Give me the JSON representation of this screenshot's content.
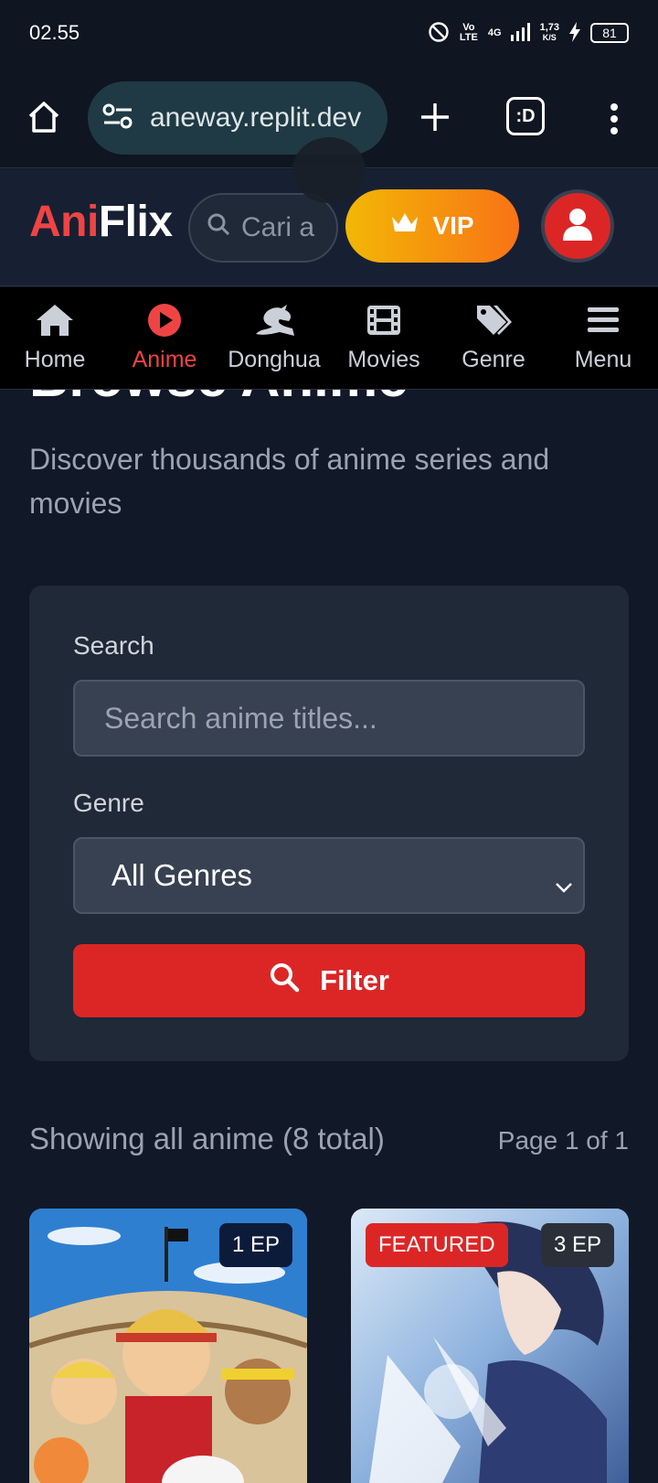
{
  "status_bar": {
    "time": "02.55",
    "volte": "Vo LTE",
    "network": "4G",
    "speed_value": "1,73",
    "speed_unit": "K/S",
    "battery": "81"
  },
  "browser": {
    "url": "aneway.replit.dev",
    "tab_count_label": ":D"
  },
  "header": {
    "logo_part1": "Ani",
    "logo_part2": "Flix",
    "search_placeholder": "Cari a",
    "vip_label": "VIP"
  },
  "nav": {
    "items": [
      {
        "label": "Home",
        "icon": "home-icon"
      },
      {
        "label": "Anime",
        "icon": "play-circle-icon",
        "active": true
      },
      {
        "label": "Donghua",
        "icon": "dragon-icon"
      },
      {
        "label": "Movies",
        "icon": "film-icon"
      },
      {
        "label": "Genre",
        "icon": "tags-icon"
      },
      {
        "label": "Menu",
        "icon": "menu-icon"
      }
    ]
  },
  "page": {
    "title": "Browse Anime",
    "subtitle": "Discover thousands of anime series and movies"
  },
  "filters": {
    "search_label": "Search",
    "search_placeholder": "Search anime titles...",
    "genre_label": "Genre",
    "genre_selected": "All Genres",
    "filter_button": "Filter"
  },
  "results": {
    "summary": "Showing all anime (8 total)",
    "pagination": "Page 1 of 1"
  },
  "cards": [
    {
      "episodes": "1 EP"
    },
    {
      "featured_label": "FEATURED",
      "episodes": "3 EP"
    }
  ],
  "colors": {
    "accent_red": "#dc2626",
    "vip_gradient_start": "#f2b705",
    "vip_gradient_end": "#f97316",
    "background": "#111827"
  }
}
